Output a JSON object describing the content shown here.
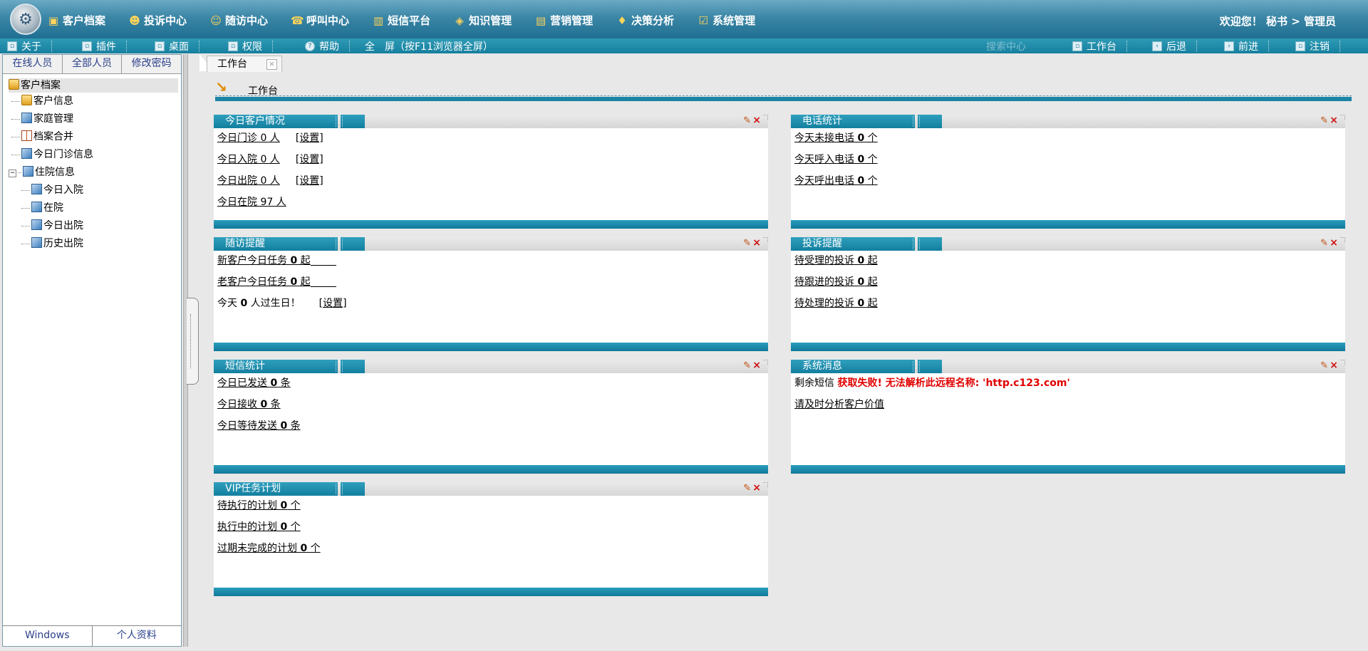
{
  "topnav": {
    "items": [
      {
        "label": "客户档案",
        "icon": "folder-icon"
      },
      {
        "label": "投诉中心",
        "icon": "people-icon"
      },
      {
        "label": "随访中心",
        "icon": "user-icon"
      },
      {
        "label": "呼叫中心",
        "icon": "phone-icon"
      },
      {
        "label": "短信平台",
        "icon": "gift-icon"
      },
      {
        "label": "知识管理",
        "icon": "cube-icon"
      },
      {
        "label": "营销管理",
        "icon": "chart-icon"
      },
      {
        "label": "决策分析",
        "icon": "key-icon"
      },
      {
        "label": "系统管理",
        "icon": "check-icon"
      }
    ],
    "welcome": "欢迎您！ 秘书 > 管理员"
  },
  "toolbar": {
    "about": "关于",
    "plugin": "插件",
    "desktop": "桌面",
    "permission": "权限",
    "help": "帮助",
    "fullscreen": "全　屏（按F11浏览器全屏）",
    "search_center": "搜索中心",
    "workbench": "工作台",
    "back": "后退",
    "forward": "前进",
    "logout": "注销"
  },
  "sidebar": {
    "tabs": [
      "在线人员",
      "全部人员",
      "修改密码"
    ],
    "root": "客户档案",
    "items": [
      {
        "label": "客户信息"
      },
      {
        "label": "家庭管理"
      },
      {
        "label": "档案合并"
      },
      {
        "label": "今日门诊信息"
      },
      {
        "label": "住院信息"
      },
      {
        "label": "今日入院"
      },
      {
        "label": "在院"
      },
      {
        "label": "今日出院"
      },
      {
        "label": "历史出院"
      }
    ],
    "bottom_tabs": [
      "Windows",
      "个人资料"
    ]
  },
  "main": {
    "tab_label": "工作台",
    "breadcrumb": "工作台",
    "set_label": "[设置]",
    "panels": {
      "today_customers": {
        "title": "今日客户情况",
        "rows": [
          "今日门诊 0 人",
          "今日入院 0 人",
          "今日出院 0 人",
          "今日在院 97 人"
        ]
      },
      "phone_stats": {
        "title": "电话统计",
        "rows": [
          {
            "pre": "今天未接电话 ",
            "num": "0",
            "post": " 个"
          },
          {
            "pre": "今天呼入电话 ",
            "num": "0",
            "post": " 个"
          },
          {
            "pre": "今天呼出电话 ",
            "num": "0",
            "post": " 个"
          }
        ]
      },
      "followup": {
        "title": "随访提醒",
        "rows": [
          {
            "pre": "新客户今日任务 ",
            "num": "0",
            "post": " 起"
          },
          {
            "pre": "老客户今日任务 ",
            "num": "0",
            "post": " 起"
          }
        ],
        "birthday": {
          "pre": "今天 ",
          "num": "0",
          "post": " 人过生日！"
        }
      },
      "complaints": {
        "title": "投诉提醒",
        "rows": [
          {
            "pre": "待受理的投诉 ",
            "num": "0",
            "post": " 起"
          },
          {
            "pre": "待跟进的投诉 ",
            "num": "0",
            "post": " 起"
          },
          {
            "pre": "待处理的投诉 ",
            "num": "0",
            "post": " 起"
          }
        ]
      },
      "sms": {
        "title": "短信统计",
        "rows": [
          {
            "pre": "今日已发送 ",
            "num": "0",
            "post": " 条"
          },
          {
            "pre": "今日接收 ",
            "num": "0",
            "post": " 条"
          },
          {
            "pre": "今日等待发送 ",
            "num": "0",
            "post": " 条"
          }
        ]
      },
      "system": {
        "title": "系统消息",
        "sms_left": "剩余短信 ",
        "error": "获取失败! 无法解析此远程名称: 'http.c123.com'",
        "link": "请及时分析客户价值"
      },
      "vip": {
        "title": "VIP任务计划",
        "rows": [
          {
            "pre": "待执行的计划 ",
            "num": "0",
            "post": " 个"
          },
          {
            "pre": "执行中的计划 ",
            "num": "0",
            "post": " 个"
          },
          {
            "pre": "过期未完成的计划 ",
            "num": "0",
            "post": " 个"
          }
        ]
      }
    }
  }
}
